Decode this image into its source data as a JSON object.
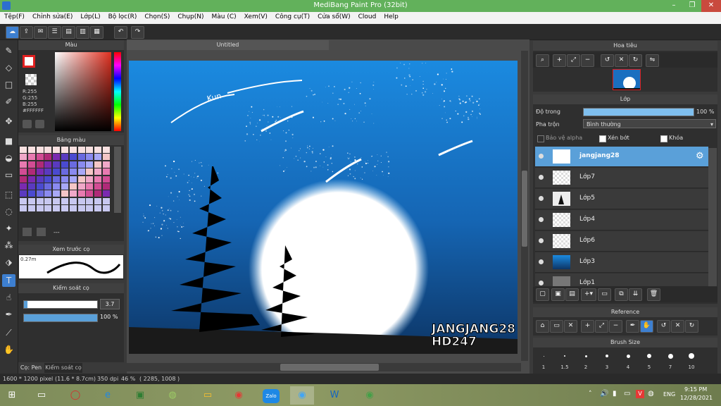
{
  "window": {
    "title": "MediBang Paint Pro (32bit)"
  },
  "menu": [
    "Tệp(F)",
    "Chỉnh sửa(E)",
    "Lớp(L)",
    "Bộ lọc(R)",
    "Chọn(S)",
    "Chụp(N)",
    "Màu (C)",
    "Xem(V)",
    "Công cụ(T)",
    "Cửa sổ(W)",
    "Cloud",
    "Help"
  ],
  "color_panel": {
    "title": "Màu",
    "r": "R:255",
    "g": "G:255",
    "b": "B:255",
    "hex": "#FFFFFF"
  },
  "palette_panel": {
    "title": "Bảng màu",
    "dash": "---"
  },
  "brush_preview_panel": {
    "title": "Xem trước cọ",
    "size": "0.27m"
  },
  "brush_control_panel": {
    "title": "Kiểm soát cọ",
    "size_value": "3.7",
    "opacity_value": "100 %",
    "opacity_level": 1.0
  },
  "left_tabs": {
    "tab1": "Cọ: Pen",
    "tab2": "Kiểm soát cọ"
  },
  "canvas": {
    "tab_title": "Untitled",
    "signature_line1": "JANGJANG28",
    "signature_line2": "HD247",
    "handwriting": "Kun"
  },
  "navigator": {
    "title": "Hoa tiêu"
  },
  "layers_panel": {
    "title": "Lớp",
    "opacity_label": "Độ trong",
    "opacity_value": "100 %",
    "blend_label": "Pha trộn",
    "blend_value": "Bình thường",
    "protect_alpha": "Bảo vệ alpha",
    "clipping": "Xén bớt",
    "lock": "Khóa",
    "layers": [
      {
        "name": "jangjang28",
        "selected": true
      },
      {
        "name": "Lớp7",
        "selected": false
      },
      {
        "name": "Lớp5",
        "selected": false
      },
      {
        "name": "Lớp4",
        "selected": false
      },
      {
        "name": "Lớp6",
        "selected": false
      },
      {
        "name": "Lớp3",
        "selected": false
      },
      {
        "name": "Lớp1",
        "selected": false
      }
    ]
  },
  "reference_panel": {
    "title": "Reference"
  },
  "brush_size_panel": {
    "title": "Brush Size",
    "sizes": [
      "1",
      "1.5",
      "2",
      "3",
      "4",
      "5",
      "7",
      "10"
    ]
  },
  "status": {
    "pixels": "1600 * 1200 pixel",
    "cm": "(11.6 * 8.7cm)",
    "dpi": "350 dpi",
    "zoom": "46 %",
    "coords": "( 2285, 1008 )"
  },
  "taskbar": {
    "lang": "ENG",
    "time": "9:15 PM",
    "date": "12/28/2021",
    "zalo": "Zalo"
  },
  "colors": {
    "titlebar": "#62b15b",
    "accent": "#5aa0d9",
    "sky_top": "#1a6fc0",
    "sky_bottom": "#0e3a6e"
  }
}
